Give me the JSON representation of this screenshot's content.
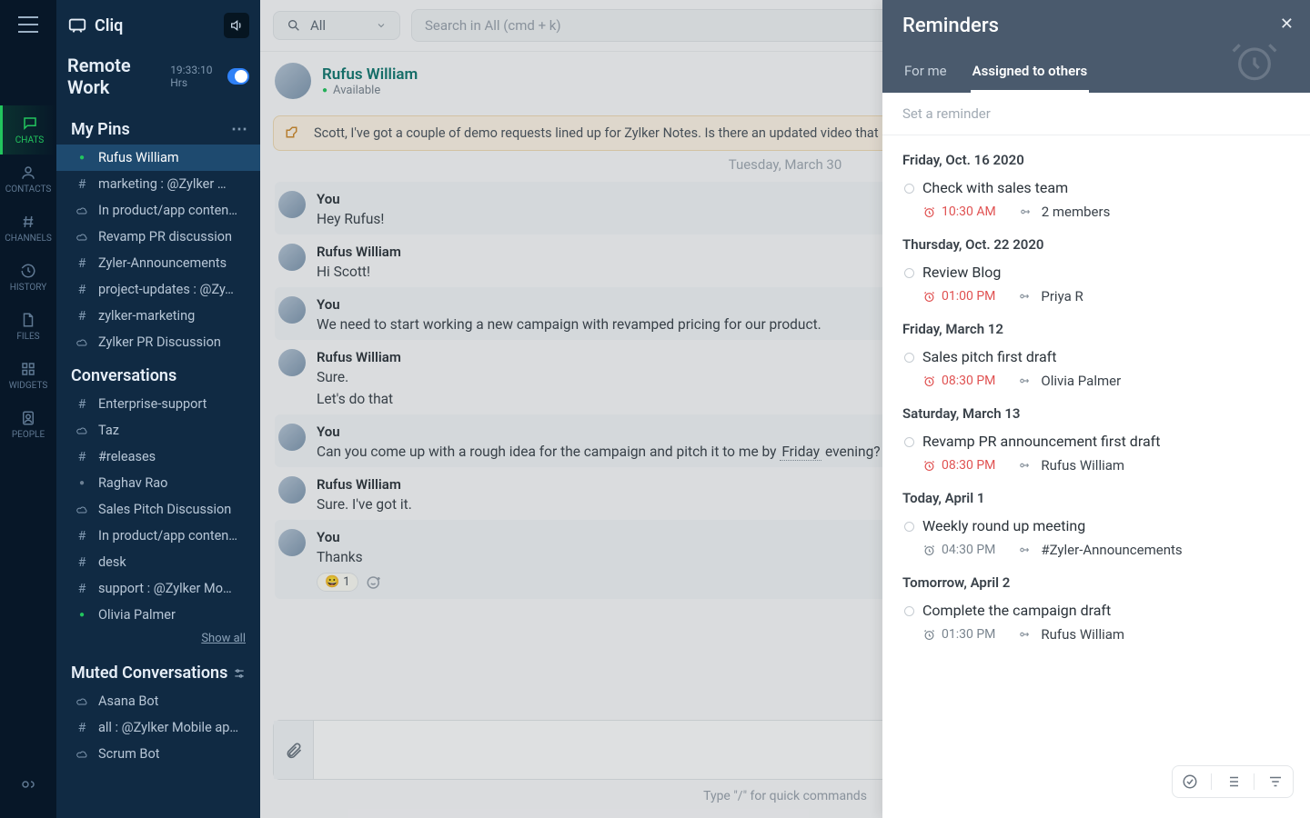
{
  "app": {
    "name": "Cliq"
  },
  "rail": {
    "items": [
      {
        "id": "chats",
        "label": "CHATS"
      },
      {
        "id": "contacts",
        "label": "CONTACTS"
      },
      {
        "id": "channels",
        "label": "CHANNELS"
      },
      {
        "id": "history",
        "label": "HISTORY"
      },
      {
        "id": "files",
        "label": "FILES"
      },
      {
        "id": "widgets",
        "label": "WIDGETS"
      },
      {
        "id": "people",
        "label": "PEOPLE"
      }
    ]
  },
  "remote": {
    "title": "Remote Work",
    "hours": "19:33:10 Hrs"
  },
  "pins": {
    "header": "My Pins",
    "items": [
      {
        "icon": "dot-green",
        "label": "Rufus William"
      },
      {
        "icon": "hash",
        "label": "marketing : @Zylker …"
      },
      {
        "icon": "cloud",
        "label": "In product/app conten…"
      },
      {
        "icon": "cloud",
        "label": "Revamp PR discussion"
      },
      {
        "icon": "hash",
        "label": "Zyler-Announcements"
      },
      {
        "icon": "hash",
        "label": "project-updates : @Zy…"
      },
      {
        "icon": "hash",
        "label": "zylker-marketing"
      },
      {
        "icon": "cloud",
        "label": "Zylker PR Discussion"
      }
    ]
  },
  "convos": {
    "header": "Conversations",
    "items": [
      {
        "icon": "hash",
        "label": "Enterprise-support"
      },
      {
        "icon": "cloud",
        "label": "Taz"
      },
      {
        "icon": "hash",
        "label": "#releases"
      },
      {
        "icon": "dot-gray",
        "label": "Raghav Rao"
      },
      {
        "icon": "cloud",
        "label": "Sales Pitch Discussion"
      },
      {
        "icon": "hash",
        "label": "In product/app conten…"
      },
      {
        "icon": "hash",
        "label": "desk"
      },
      {
        "icon": "hash",
        "label": "support : @Zylker Mo…"
      },
      {
        "icon": "dot-green",
        "label": "Olivia Palmer"
      }
    ],
    "show_all": "Show all"
  },
  "muted": {
    "header": "Muted Conversations",
    "items": [
      {
        "icon": "cloud",
        "label": "Asana Bot"
      },
      {
        "icon": "hash",
        "label": "all : @Zylker Mobile ap…"
      },
      {
        "icon": "cloud",
        "label": "Scrum Bot"
      }
    ]
  },
  "topbar": {
    "scope": "All",
    "search_placeholder": "Search in All (cmd + k)"
  },
  "contact": {
    "name": "Rufus William",
    "status": "Available"
  },
  "pinned_note": "Scott, I've got a couple of demo requests lined up for Zylker Notes. Is there an updated video that I can share with",
  "date_divider": "Tuesday, March 30",
  "messages": [
    {
      "sender": "You",
      "alt": true,
      "lines": [
        "Hey Rufus!"
      ]
    },
    {
      "sender": "Rufus William",
      "alt": false,
      "lines": [
        "Hi Scott!"
      ]
    },
    {
      "sender": "You",
      "alt": true,
      "lines": [
        "We need to start working a new campaign with revamped pricing for our product."
      ]
    },
    {
      "sender": "Rufus William",
      "alt": false,
      "lines": [
        "Sure.",
        "Let's do that"
      ]
    },
    {
      "sender": "You",
      "alt": true,
      "lines": [
        "Can you come up with a rough idea for the campaign and pitch it to me by  {u}Friday{/u}  evening? We c"
      ]
    },
    {
      "sender": "Rufus William",
      "alt": false,
      "lines": [
        "Sure. I've got it."
      ]
    },
    {
      "sender": "You",
      "alt": true,
      "lines": [
        "Thanks"
      ],
      "reaction": {
        "emoji": "😀",
        "count": "1"
      }
    }
  ],
  "composer_hint": "Type \"/\" for quick commands",
  "panel": {
    "title": "Reminders",
    "tabs": {
      "for_me": "For me",
      "assigned": "Assigned to others"
    },
    "input_placeholder": "Set a reminder",
    "groups": [
      {
        "date": "Friday, Oct. 16 2020",
        "items": [
          {
            "title": "Check with sales team",
            "time": "10:30 AM",
            "time_color": "red",
            "assignee": "2 members"
          }
        ]
      },
      {
        "date": "Thursday, Oct. 22 2020",
        "items": [
          {
            "title": "Review Blog",
            "time": "01:00 PM",
            "time_color": "red",
            "assignee": "Priya R"
          }
        ]
      },
      {
        "date": "Friday, March 12",
        "items": [
          {
            "title": "Sales pitch first draft",
            "time": "08:30 PM",
            "time_color": "red",
            "assignee": "Olivia Palmer"
          }
        ]
      },
      {
        "date": "Saturday, March 13",
        "items": [
          {
            "title": "Revamp PR announcement first draft",
            "time": "08:30 PM",
            "time_color": "red",
            "assignee": "Rufus William"
          }
        ]
      },
      {
        "date": "Today, April 1",
        "items": [
          {
            "title": "Weekly round up meeting",
            "time": "04:30 PM",
            "time_color": "neutral",
            "assignee": "#Zyler-Announcements"
          }
        ]
      },
      {
        "date": "Tomorrow, April 2",
        "items": [
          {
            "title": "Complete the campaign draft",
            "time": "01:30 PM",
            "time_color": "neutral",
            "assignee": "Rufus William"
          }
        ]
      }
    ]
  }
}
